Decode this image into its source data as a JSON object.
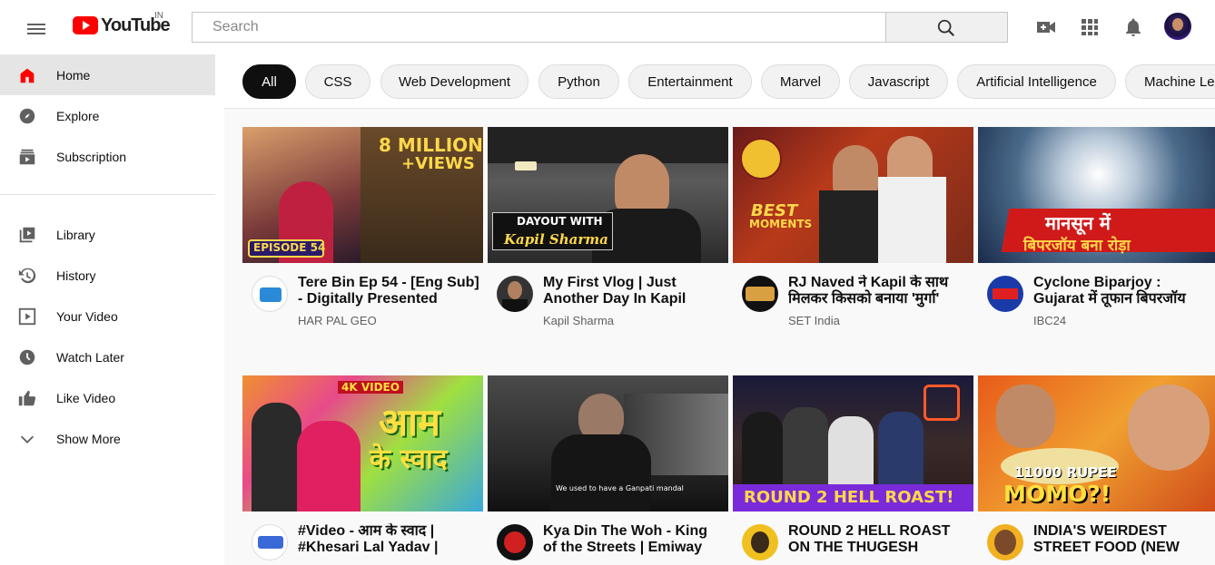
{
  "header": {
    "logo_text": "YouTube",
    "country_code": "IN",
    "search_placeholder": "Search"
  },
  "sidebar": {
    "items": [
      {
        "label": "Home",
        "icon": "home-icon",
        "active": true
      },
      {
        "label": "Explore",
        "icon": "compass-icon"
      },
      {
        "label": "Subscription",
        "icon": "subscriptions-icon"
      },
      {
        "label": "Library",
        "icon": "library-icon"
      },
      {
        "label": "History",
        "icon": "history-icon"
      },
      {
        "label": "Your Video",
        "icon": "your-videos-icon"
      },
      {
        "label": "Watch Later",
        "icon": "clock-icon"
      },
      {
        "label": "Like Video",
        "icon": "thumbs-up-icon"
      },
      {
        "label": "Show More",
        "icon": "chevron-down-icon"
      }
    ]
  },
  "chips": [
    "All",
    "CSS",
    "Web Development",
    "Python",
    "Entertainment",
    "Marvel",
    "Javascript",
    "Artificial Intelligence",
    "Machine Le"
  ],
  "videos": [
    {
      "title": "Tere Bin Ep 54 - [Eng Sub] - Digitally Presented",
      "channel": "HAR PAL GEO",
      "thumb_texts": [
        "8 MILLION",
        "+VIEWS",
        "EPISODE 54"
      ]
    },
    {
      "title": "My First Vlog | Just Another Day In Kapil",
      "channel": "Kapil Sharma",
      "thumb_texts": [
        "DAYOUT WITH",
        "Kapil Sharma"
      ]
    },
    {
      "title": "RJ Naved ने Kapil के साथ मिलकर किसको बनाया 'मुर्गा'",
      "channel": "SET India",
      "thumb_texts": [
        "BEST",
        "MOMENTS"
      ]
    },
    {
      "title": "Cyclone Biparjoy : Gujarat में तूफान बिपरजॉय",
      "channel": "IBC24",
      "thumb_texts": [
        "मानसून में",
        "बिपरजॉय बना रोड़ा"
      ]
    },
    {
      "title": "#Video - आम के स्वाद | #Khesari Lal Yadav |",
      "channel": "",
      "thumb_texts": [
        "4K VIDEO",
        "आम",
        "के स्वाद"
      ]
    },
    {
      "title": "Kya Din The Woh - King of the Streets | Emiway",
      "channel": "",
      "thumb_texts": [
        "We used to have a Ganpati mandal"
      ]
    },
    {
      "title": "ROUND 2 HELL ROAST ON THE THUGESH",
      "channel": "",
      "thumb_texts": [
        "ROUND 2 HELL ROAST!"
      ]
    },
    {
      "title": "INDIA'S WEIRDEST STREET FOOD (NEW",
      "channel": "",
      "thumb_texts": [
        "11000 RUPEE",
        "MOMO?!"
      ]
    }
  ],
  "colors": {
    "brand_red": "#ff0000",
    "active_chip": "#0f0f0f",
    "sidebar_active": "#e5e5e5"
  }
}
